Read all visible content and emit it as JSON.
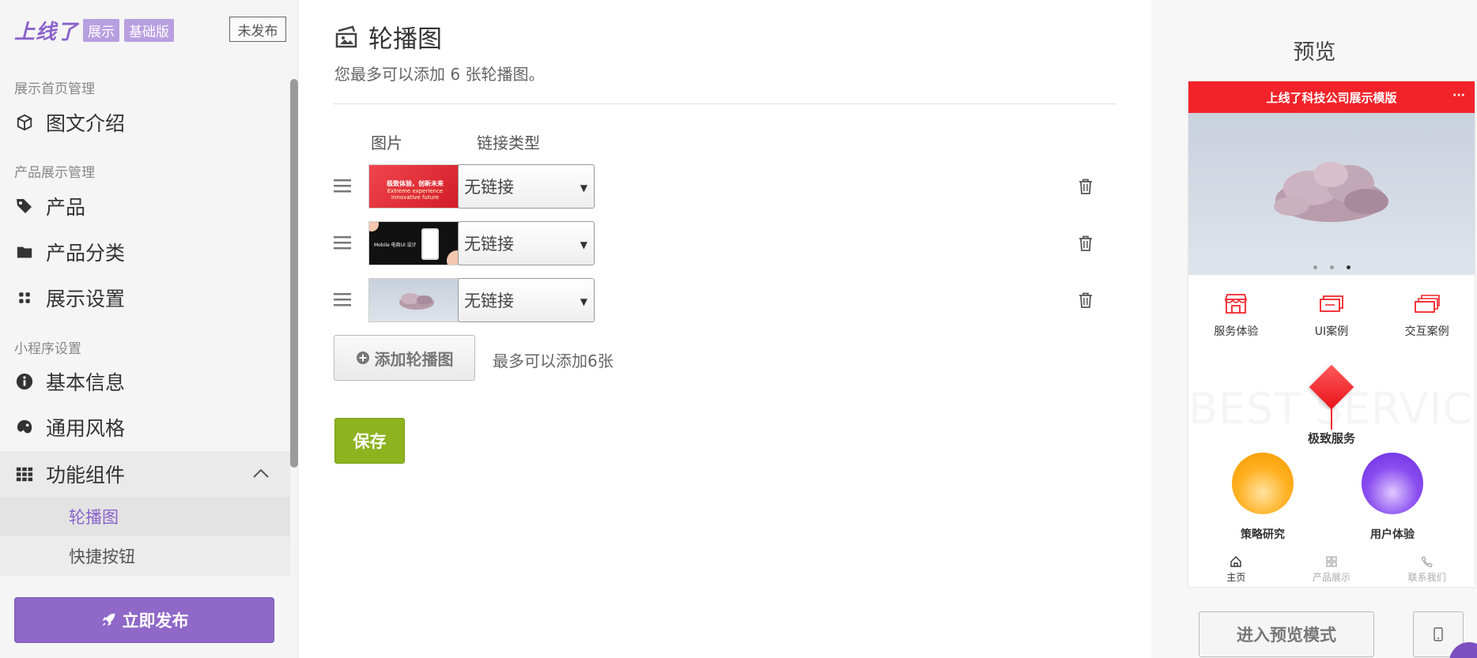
{
  "sidebar": {
    "logo": "上线了",
    "tags": [
      "展示",
      "基础版"
    ],
    "status": "未发布",
    "sections": [
      {
        "title": "展示首页管理",
        "items": [
          "图文介绍"
        ]
      },
      {
        "title": "产品展示管理",
        "items": [
          "产品",
          "产品分类",
          "展示设置"
        ]
      },
      {
        "title": "小程序设置",
        "items": [
          "基本信息",
          "通用风格",
          "功能组件"
        ]
      }
    ],
    "submenu": [
      "轮播图",
      "快捷按钮"
    ],
    "publish": "立即发布",
    "colors": {
      "accent": "#8a63c9"
    }
  },
  "main": {
    "title": "轮播图",
    "subtitle": "您最多可以添加 6 张轮播图。",
    "columns": [
      "图片",
      "链接类型"
    ],
    "rows": [
      {
        "link": "无链接",
        "thumb_text": [
          "极致体验，创新未来",
          "Extreme experience",
          "Innovative future"
        ]
      },
      {
        "link": "无链接",
        "thumb_text": [
          "Mobile 电商UI 设计"
        ]
      },
      {
        "link": "无链接"
      }
    ],
    "add_button": "添加轮播图",
    "add_note": "最多可以添加6张",
    "save": "保存"
  },
  "preview": {
    "title": "预览",
    "app_title": "上线了科技公司展示模版",
    "more": "···",
    "icons": [
      "服务体验",
      "UI案例",
      "交互案例"
    ],
    "watermark": "BEST SERVICE",
    "highlight": "极致服务",
    "cards": [
      "策略研究",
      "用户体验"
    ],
    "tabs": [
      "主页",
      "产品展示",
      "联系我们"
    ],
    "enter": "进入预览模式",
    "colors": {
      "brand": "#f2232a"
    }
  }
}
